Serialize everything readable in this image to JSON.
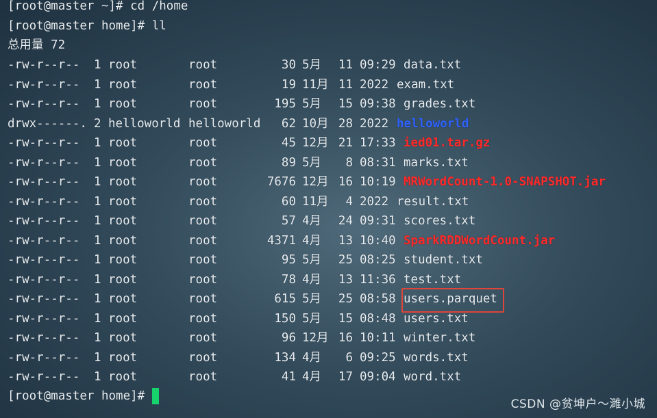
{
  "commands": {
    "line1": "[root@master ~]# cd /home",
    "line2": "[root@master home]# ll",
    "total": "总用量 72",
    "prompt": "[root@master home]# "
  },
  "listing": [
    {
      "perm": "-rw-r--r--",
      "links": "1",
      "owner": "root",
      "group": "root",
      "size": "30",
      "month": "5月",
      "day": "11",
      "time": "09:29",
      "name": "data.txt",
      "style": "normal"
    },
    {
      "perm": "-rw-r--r--",
      "links": "1",
      "owner": "root",
      "group": "root",
      "size": "19",
      "month": "11月",
      "day": "11",
      "time": "2022",
      "name": "exam.txt",
      "style": "normal",
      "year": true
    },
    {
      "perm": "-rw-r--r--",
      "links": "1",
      "owner": "root",
      "group": "root",
      "size": "195",
      "month": "5月",
      "day": "15",
      "time": "09:38",
      "name": "grades.txt",
      "style": "normal"
    },
    {
      "perm": "drwx------.",
      "links": "2",
      "owner": "helloworld",
      "group": "helloworld",
      "size": "62",
      "month": "10月",
      "day": "28",
      "time": "2022",
      "name": "helloworld",
      "style": "blue",
      "year": true
    },
    {
      "perm": "-rw-r--r--",
      "links": "1",
      "owner": "root",
      "group": "root",
      "size": "45",
      "month": "12月",
      "day": "21",
      "time": "17:33",
      "name": "ied01.tar.gz",
      "style": "red"
    },
    {
      "perm": "-rw-r--r--",
      "links": "1",
      "owner": "root",
      "group": "root",
      "size": "89",
      "month": "5月",
      "day": "8",
      "time": "08:31",
      "name": "marks.txt",
      "style": "normal"
    },
    {
      "perm": "-rw-r--r--",
      "links": "1",
      "owner": "root",
      "group": "root",
      "size": "7676",
      "month": "12月",
      "day": "16",
      "time": "10:19",
      "name": "MRWordCount-1.0-SNAPSHOT.jar",
      "style": "red"
    },
    {
      "perm": "-rw-r--r--",
      "links": "1",
      "owner": "root",
      "group": "root",
      "size": "60",
      "month": "11月",
      "day": "4",
      "time": "2022",
      "name": "result.txt",
      "style": "normal",
      "year": true
    },
    {
      "perm": "-rw-r--r--",
      "links": "1",
      "owner": "root",
      "group": "root",
      "size": "57",
      "month": "4月",
      "day": "24",
      "time": "09:31",
      "name": "scores.txt",
      "style": "normal"
    },
    {
      "perm": "-rw-r--r--",
      "links": "1",
      "owner": "root",
      "group": "root",
      "size": "4371",
      "month": "4月",
      "day": "13",
      "time": "10:40",
      "name": "SparkRDDWordCount.jar",
      "style": "red"
    },
    {
      "perm": "-rw-r--r--",
      "links": "1",
      "owner": "root",
      "group": "root",
      "size": "95",
      "month": "5月",
      "day": "25",
      "time": "08:25",
      "name": "student.txt",
      "style": "normal"
    },
    {
      "perm": "-rw-r--r--",
      "links": "1",
      "owner": "root",
      "group": "root",
      "size": "78",
      "month": "4月",
      "day": "13",
      "time": "11:36",
      "name": "test.txt",
      "style": "normal"
    },
    {
      "perm": "-rw-r--r--",
      "links": "1",
      "owner": "root",
      "group": "root",
      "size": "615",
      "month": "5月",
      "day": "25",
      "time": "08:58",
      "name": "users.parquet",
      "style": "normal",
      "highlighted": true
    },
    {
      "perm": "-rw-r--r--",
      "links": "1",
      "owner": "root",
      "group": "root",
      "size": "150",
      "month": "5月",
      "day": "15",
      "time": "08:48",
      "name": "users.txt",
      "style": "normal"
    },
    {
      "perm": "-rw-r--r--",
      "links": "1",
      "owner": "root",
      "group": "root",
      "size": "96",
      "month": "12月",
      "day": "16",
      "time": "10:11",
      "name": "winter.txt",
      "style": "normal"
    },
    {
      "perm": "-rw-r--r--",
      "links": "1",
      "owner": "root",
      "group": "root",
      "size": "134",
      "month": "4月",
      "day": "6",
      "time": "09:25",
      "name": "words.txt",
      "style": "normal"
    },
    {
      "perm": "-rw-r--r--",
      "links": "1",
      "owner": "root",
      "group": "root",
      "size": "41",
      "month": "4月",
      "day": "17",
      "time": "09:04",
      "name": "word.txt",
      "style": "normal"
    }
  ],
  "watermark": "CSDN @贫坤户～濉小城",
  "colors": {
    "text": "#e8eef2",
    "archive_red": "#ff2a2a",
    "directory_blue": "#2f62ff",
    "cursor_green": "#17d36b",
    "highlight_box": "#e0453a"
  }
}
